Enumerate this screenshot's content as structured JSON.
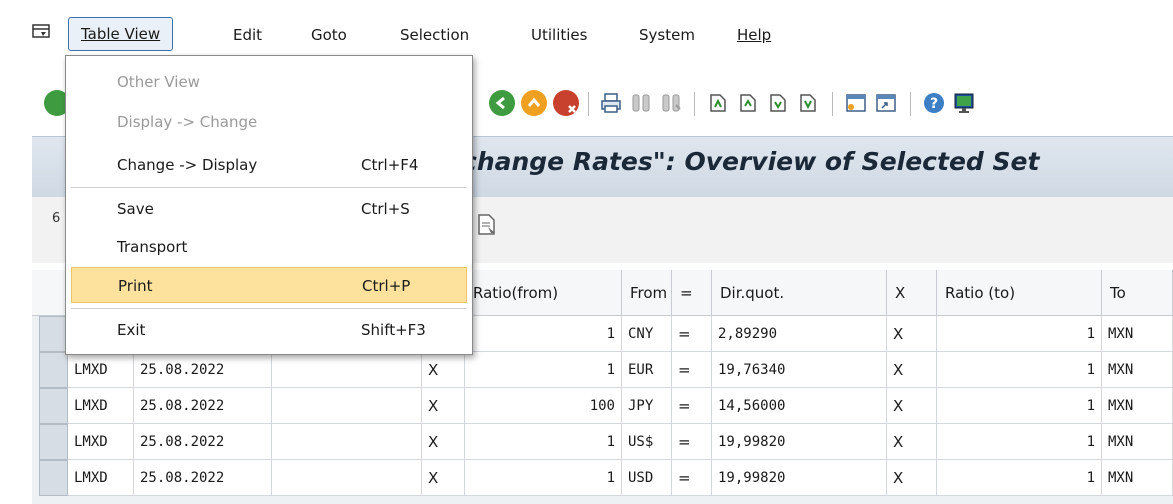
{
  "menubar": {
    "items": [
      {
        "label": "Table View",
        "active": true
      },
      {
        "label": "Edit"
      },
      {
        "label": "Goto"
      },
      {
        "label": "Selection"
      },
      {
        "label": "Utilities"
      },
      {
        "label": "System"
      },
      {
        "label": "Help"
      }
    ]
  },
  "dropdown": {
    "items": [
      {
        "label": "Other View",
        "shortcut": "",
        "disabled": true
      },
      {
        "label": "Display -> Change",
        "shortcut": "",
        "disabled": true
      },
      {
        "label": "Change -> Display",
        "shortcut": "Ctrl+F4"
      },
      {
        "label": "Save",
        "shortcut": "Ctrl+S"
      },
      {
        "label": "Transport",
        "shortcut": ""
      },
      {
        "label": "Print",
        "shortcut": "Ctrl+P",
        "highlighted": true
      },
      {
        "label": "Exit",
        "shortcut": "Shift+F3"
      }
    ]
  },
  "title": "change Rates\": Overview of Selected Set",
  "apptoolbar": {
    "count_fragment": "6"
  },
  "table": {
    "headers": [
      "Ratio(from)",
      "From",
      "=",
      "Dir.quot.",
      "X",
      "Ratio (to)",
      "To"
    ],
    "rows": [
      {
        "rate_type": "",
        "valid_from": "",
        "x1": "",
        "ratio_from": "1",
        "from": "CNY",
        "eq": "=",
        "dir_quot": "2,89290",
        "x2": "X",
        "ratio_to": "1",
        "to": "MXN"
      },
      {
        "rate_type": "LMXD",
        "valid_from": "25.08.2022",
        "x1": "X",
        "ratio_from": "1",
        "from": "EUR",
        "eq": "=",
        "dir_quot": "19,76340",
        "x2": "X",
        "ratio_to": "1",
        "to": "MXN"
      },
      {
        "rate_type": "LMXD",
        "valid_from": "25.08.2022",
        "x1": "X",
        "ratio_from": "100",
        "from": "JPY",
        "eq": "=",
        "dir_quot": "14,56000",
        "x2": "X",
        "ratio_to": "1",
        "to": "MXN"
      },
      {
        "rate_type": "LMXD",
        "valid_from": "25.08.2022",
        "x1": "X",
        "ratio_from": "1",
        "from": "US$",
        "eq": "=",
        "dir_quot": "19,99820",
        "x2": "X",
        "ratio_to": "1",
        "to": "MXN"
      },
      {
        "rate_type": "LMXD",
        "valid_from": "25.08.2022",
        "x1": "X",
        "ratio_from": "1",
        "from": "USD",
        "eq": "=",
        "dir_quot": "19,99820",
        "x2": "X",
        "ratio_to": "1",
        "to": "MXN"
      }
    ]
  },
  "colors": {
    "accent_green": "#3f9b3f",
    "accent_orange": "#f0a020",
    "accent_red": "#c8402e",
    "highlight": "#fce29d",
    "title_bar": "#d5dde6"
  }
}
